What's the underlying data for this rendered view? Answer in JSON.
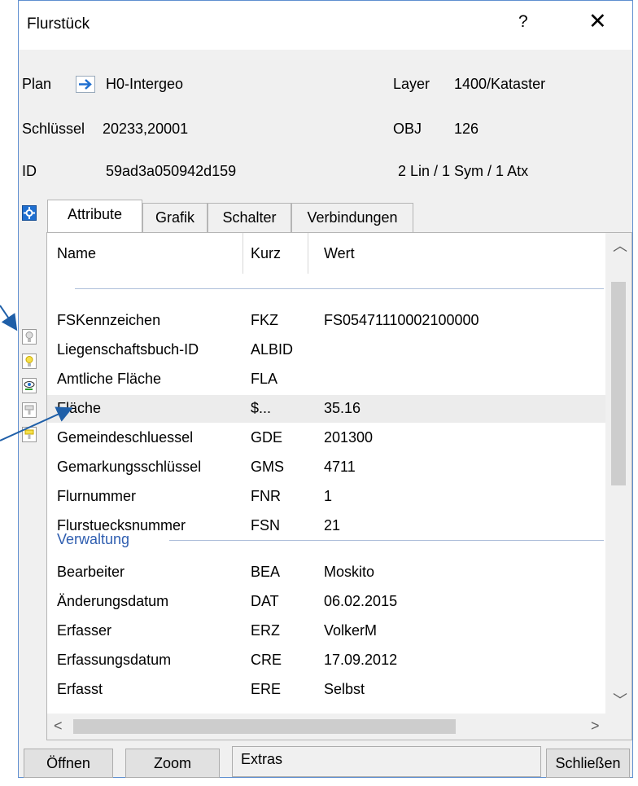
{
  "dialog": {
    "title": "Flurstück",
    "help_label": "?",
    "close_label": "✕"
  },
  "info": {
    "plan_label": "Plan",
    "plan_value": "H0-Intergeo",
    "layer_label": "Layer",
    "layer_value": "1400/Kataster",
    "schluessel_label": "Schlüssel",
    "schluessel_value": "20233,20001",
    "obj_label": "OBJ",
    "obj_value": "126",
    "id_label": "ID",
    "id_value": "59ad3a050942d159",
    "counts": "2 Lin / 1 Sym / 1 Atx"
  },
  "tabs": [
    {
      "label": "Attribute"
    },
    {
      "label": "Grafik"
    },
    {
      "label": "Schalter"
    },
    {
      "label": "Verbindungen"
    }
  ],
  "columns": {
    "name": "Name",
    "kurz": "Kurz",
    "wert": "Wert"
  },
  "rows_main": [
    {
      "name": "FSKennzeichen",
      "kurz": "FKZ",
      "wert": "FS05471110002100000"
    },
    {
      "name": "Liegenschaftsbuch-ID",
      "kurz": "ALBID",
      "wert": ""
    },
    {
      "name": "Amtliche Fläche",
      "kurz": "FLA",
      "wert": ""
    },
    {
      "name": "Fläche",
      "kurz": "$...",
      "wert": "35.16"
    },
    {
      "name": "Gemeindeschluessel",
      "kurz": "GDE",
      "wert": "201300"
    },
    {
      "name": "Gemarkungsschlüssel",
      "kurz": "GMS",
      "wert": "4711"
    },
    {
      "name": "Flurnummer",
      "kurz": "FNR",
      "wert": "1"
    },
    {
      "name": "Flurstuecksnummer",
      "kurz": "FSN",
      "wert": "21"
    }
  ],
  "group": {
    "title": "Verwaltung"
  },
  "rows_admin": [
    {
      "name": "Bearbeiter",
      "kurz": "BEA",
      "wert": "Moskito"
    },
    {
      "name": "Änderungsdatum",
      "kurz": "DAT",
      "wert": "06.02.2015"
    },
    {
      "name": "Erfasser",
      "kurz": "ERZ",
      "wert": "VolkerM"
    },
    {
      "name": "Erfassungsdatum",
      "kurz": "CRE",
      "wert": "17.09.2012"
    },
    {
      "name": "Erfasst",
      "kurz": "ERE",
      "wert": "Selbst"
    }
  ],
  "buttons": {
    "open": "Öffnen",
    "zoom": "Zoom",
    "extras": "Extras",
    "close": "Schließen"
  },
  "colors": {
    "accent": "#2f5eb0",
    "annotation_arrow": "#1f5fa8",
    "highlight_row": "#ececec"
  }
}
